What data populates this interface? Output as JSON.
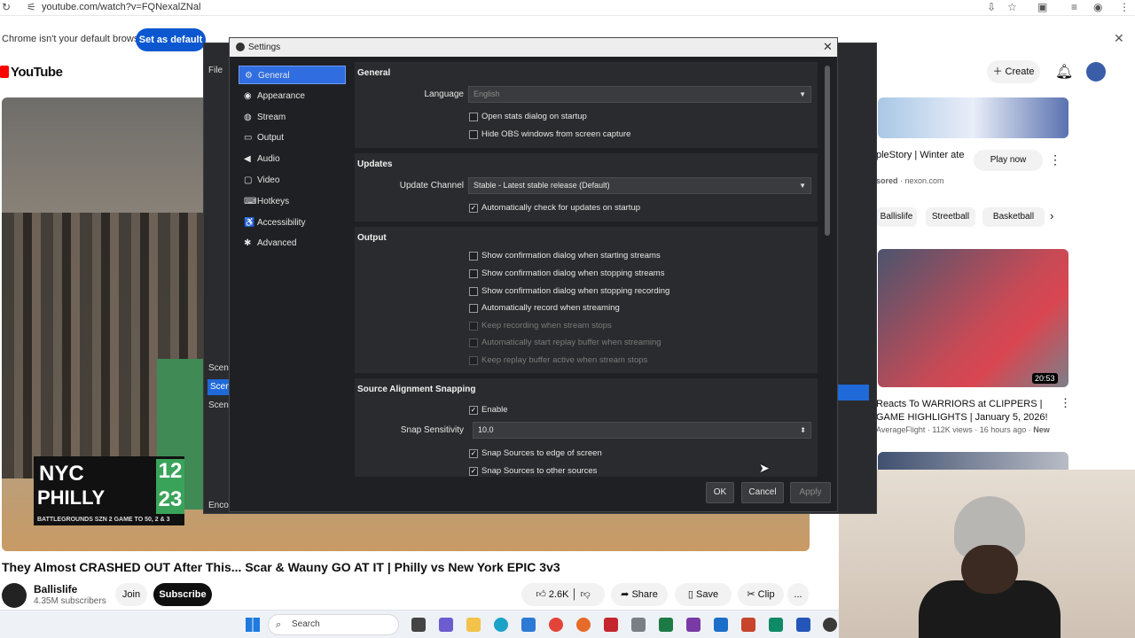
{
  "browser": {
    "url": "youtube.com/watch?v=FQNexalZNal",
    "infobar_message": "Chrome isn't your default browser",
    "set_default_label": "Set as default"
  },
  "youtube": {
    "logo": "YouTube",
    "create_label": "Create",
    "video_title": "They Almost CRASHED OUT After This... Scar & Wauny GO AT IT | Philly vs New York EPIC 3v3",
    "channel_name": "Ballislife",
    "subscribers": "4.35M subscribers",
    "join_label": "Join",
    "subscribe_label": "Subscribe",
    "like_count": "2.6K",
    "share_label": "Share",
    "save_label": "Save",
    "clip_label": "Clip",
    "more_label": "...",
    "scoreboard": {
      "team1": "NYC",
      "team2": "PHILLY",
      "score1": "12",
      "score2": "23",
      "caption": "BATTLEGROUNDS SZN 2 GAME TO 50, 2 & 3"
    },
    "ad": {
      "title": "pleStory | Winter ate",
      "sponsor_prefix": "sored",
      "domain": "nexon.com",
      "cta": "Play now"
    },
    "chips": [
      "Ballislife",
      "Streetball",
      "Basketball"
    ],
    "rec1": {
      "title": "Reacts To WARRIORS at CLIPPERS | GAME HIGHLIGHTS | January 5, 2026!",
      "channel": "AverageFlight",
      "views": "112K views",
      "age": "16 hours ago",
      "badge": "New",
      "duration": "20:53"
    }
  },
  "obs_background": {
    "file_menu": "File",
    "scene_header": "Scene",
    "scene_items": [
      "Scene",
      "Scene"
    ],
    "encoding": "Enco"
  },
  "settings": {
    "window_title": "Settings",
    "nav": [
      {
        "label": "General",
        "icon": "gear-icon",
        "glyph": "⚙"
      },
      {
        "label": "Appearance",
        "icon": "palette-icon",
        "glyph": "◉"
      },
      {
        "label": "Stream",
        "icon": "globe-icon",
        "glyph": "◍"
      },
      {
        "label": "Output",
        "icon": "monitor-icon",
        "glyph": "▭"
      },
      {
        "label": "Audio",
        "icon": "speaker-icon",
        "glyph": "◀"
      },
      {
        "label": "Video",
        "icon": "video-icon",
        "glyph": "▢"
      },
      {
        "label": "Hotkeys",
        "icon": "keyboard-icon",
        "glyph": "⌨"
      },
      {
        "label": "Accessibility",
        "icon": "accessibility-icon",
        "glyph": "♿"
      },
      {
        "label": "Advanced",
        "icon": "wrench-icon",
        "glyph": "✱"
      }
    ],
    "general": {
      "header": "General",
      "language_label": "Language",
      "language_value": "English",
      "open_stats": "Open stats dialog on startup",
      "hide_obs": "Hide OBS windows from screen capture"
    },
    "updates": {
      "header": "Updates",
      "channel_label": "Update Channel",
      "channel_value": "Stable - Latest stable release (Default)",
      "auto_check": "Automatically check for updates on startup"
    },
    "output": {
      "header": "Output",
      "options": [
        {
          "label": "Show confirmation dialog when starting streams",
          "checked": false,
          "enabled": true
        },
        {
          "label": "Show confirmation dialog when stopping streams",
          "checked": false,
          "enabled": true
        },
        {
          "label": "Show confirmation dialog when stopping recording",
          "checked": false,
          "enabled": true
        },
        {
          "label": "Automatically record when streaming",
          "checked": false,
          "enabled": true
        },
        {
          "label": "Keep recording when stream stops",
          "checked": false,
          "enabled": false
        },
        {
          "label": "Automatically start replay buffer when streaming",
          "checked": false,
          "enabled": false
        },
        {
          "label": "Keep replay buffer active when stream stops",
          "checked": false,
          "enabled": false
        }
      ]
    },
    "snapping": {
      "header": "Source Alignment Snapping",
      "enable": "Enable",
      "sensitivity_label": "Snap Sensitivity",
      "sensitivity_value": "10.0",
      "edge": "Snap Sources to edge of screen",
      "other": "Snap Sources to other sources"
    },
    "buttons": {
      "ok": "OK",
      "cancel": "Cancel",
      "apply": "Apply"
    }
  },
  "taskbar": {
    "search_placeholder": "Search"
  },
  "colors": {
    "accent": "#2f6de0",
    "dialog_bg": "#1f2023",
    "section_bg": "#2a2b2e",
    "youtube_red": "#ff0000",
    "subscribe_bg": "#0f0f0f"
  }
}
